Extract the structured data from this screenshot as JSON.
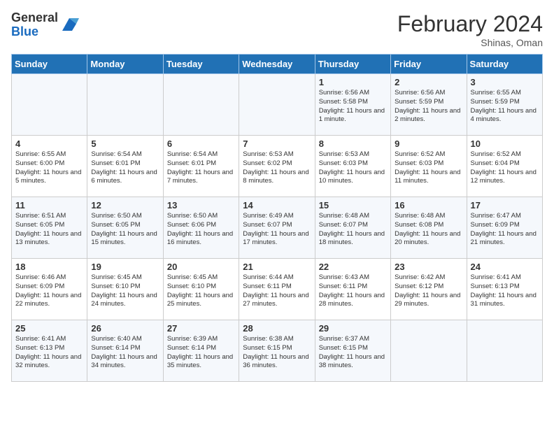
{
  "header": {
    "logo_general": "General",
    "logo_blue": "Blue",
    "title": "February 2024",
    "subtitle": "Shinas, Oman"
  },
  "days_of_week": [
    "Sunday",
    "Monday",
    "Tuesday",
    "Wednesday",
    "Thursday",
    "Friday",
    "Saturday"
  ],
  "weeks": [
    [
      {
        "num": "",
        "info": ""
      },
      {
        "num": "",
        "info": ""
      },
      {
        "num": "",
        "info": ""
      },
      {
        "num": "",
        "info": ""
      },
      {
        "num": "1",
        "info": "Sunrise: 6:56 AM\nSunset: 5:58 PM\nDaylight: 11 hours and 1 minute."
      },
      {
        "num": "2",
        "info": "Sunrise: 6:56 AM\nSunset: 5:59 PM\nDaylight: 11 hours and 2 minutes."
      },
      {
        "num": "3",
        "info": "Sunrise: 6:55 AM\nSunset: 5:59 PM\nDaylight: 11 hours and 4 minutes."
      }
    ],
    [
      {
        "num": "4",
        "info": "Sunrise: 6:55 AM\nSunset: 6:00 PM\nDaylight: 11 hours and 5 minutes."
      },
      {
        "num": "5",
        "info": "Sunrise: 6:54 AM\nSunset: 6:01 PM\nDaylight: 11 hours and 6 minutes."
      },
      {
        "num": "6",
        "info": "Sunrise: 6:54 AM\nSunset: 6:01 PM\nDaylight: 11 hours and 7 minutes."
      },
      {
        "num": "7",
        "info": "Sunrise: 6:53 AM\nSunset: 6:02 PM\nDaylight: 11 hours and 8 minutes."
      },
      {
        "num": "8",
        "info": "Sunrise: 6:53 AM\nSunset: 6:03 PM\nDaylight: 11 hours and 10 minutes."
      },
      {
        "num": "9",
        "info": "Sunrise: 6:52 AM\nSunset: 6:03 PM\nDaylight: 11 hours and 11 minutes."
      },
      {
        "num": "10",
        "info": "Sunrise: 6:52 AM\nSunset: 6:04 PM\nDaylight: 11 hours and 12 minutes."
      }
    ],
    [
      {
        "num": "11",
        "info": "Sunrise: 6:51 AM\nSunset: 6:05 PM\nDaylight: 11 hours and 13 minutes."
      },
      {
        "num": "12",
        "info": "Sunrise: 6:50 AM\nSunset: 6:05 PM\nDaylight: 11 hours and 15 minutes."
      },
      {
        "num": "13",
        "info": "Sunrise: 6:50 AM\nSunset: 6:06 PM\nDaylight: 11 hours and 16 minutes."
      },
      {
        "num": "14",
        "info": "Sunrise: 6:49 AM\nSunset: 6:07 PM\nDaylight: 11 hours and 17 minutes."
      },
      {
        "num": "15",
        "info": "Sunrise: 6:48 AM\nSunset: 6:07 PM\nDaylight: 11 hours and 18 minutes."
      },
      {
        "num": "16",
        "info": "Sunrise: 6:48 AM\nSunset: 6:08 PM\nDaylight: 11 hours and 20 minutes."
      },
      {
        "num": "17",
        "info": "Sunrise: 6:47 AM\nSunset: 6:09 PM\nDaylight: 11 hours and 21 minutes."
      }
    ],
    [
      {
        "num": "18",
        "info": "Sunrise: 6:46 AM\nSunset: 6:09 PM\nDaylight: 11 hours and 22 minutes."
      },
      {
        "num": "19",
        "info": "Sunrise: 6:45 AM\nSunset: 6:10 PM\nDaylight: 11 hours and 24 minutes."
      },
      {
        "num": "20",
        "info": "Sunrise: 6:45 AM\nSunset: 6:10 PM\nDaylight: 11 hours and 25 minutes."
      },
      {
        "num": "21",
        "info": "Sunrise: 6:44 AM\nSunset: 6:11 PM\nDaylight: 11 hours and 27 minutes."
      },
      {
        "num": "22",
        "info": "Sunrise: 6:43 AM\nSunset: 6:11 PM\nDaylight: 11 hours and 28 minutes."
      },
      {
        "num": "23",
        "info": "Sunrise: 6:42 AM\nSunset: 6:12 PM\nDaylight: 11 hours and 29 minutes."
      },
      {
        "num": "24",
        "info": "Sunrise: 6:41 AM\nSunset: 6:13 PM\nDaylight: 11 hours and 31 minutes."
      }
    ],
    [
      {
        "num": "25",
        "info": "Sunrise: 6:41 AM\nSunset: 6:13 PM\nDaylight: 11 hours and 32 minutes."
      },
      {
        "num": "26",
        "info": "Sunrise: 6:40 AM\nSunset: 6:14 PM\nDaylight: 11 hours and 34 minutes."
      },
      {
        "num": "27",
        "info": "Sunrise: 6:39 AM\nSunset: 6:14 PM\nDaylight: 11 hours and 35 minutes."
      },
      {
        "num": "28",
        "info": "Sunrise: 6:38 AM\nSunset: 6:15 PM\nDaylight: 11 hours and 36 minutes."
      },
      {
        "num": "29",
        "info": "Sunrise: 6:37 AM\nSunset: 6:15 PM\nDaylight: 11 hours and 38 minutes."
      },
      {
        "num": "",
        "info": ""
      },
      {
        "num": "",
        "info": ""
      }
    ]
  ]
}
